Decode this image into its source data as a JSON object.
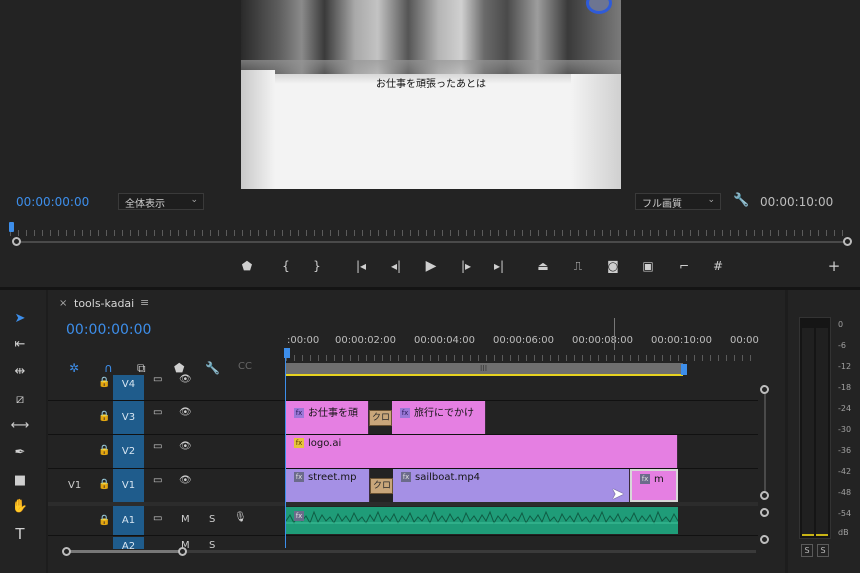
{
  "program_monitor": {
    "caption": "お仕事を頑張ったあとは",
    "current_timecode": "00:00:00:00",
    "zoom": "全体表示",
    "quality": "フル画質",
    "duration": "00:00:10:00"
  },
  "transport_icons": [
    "marker-icon",
    "mark-in-icon",
    "mark-out-icon",
    "go-to-in-icon",
    "step-back-icon",
    "play-icon",
    "step-forward-icon",
    "go-to-out-icon",
    "lift-icon",
    "extract-icon",
    "export-frame-icon",
    "comparison-view-icon",
    "safe-margins-icon",
    "grid-icon",
    "add-button-icon"
  ],
  "tools": [
    "selection-tool-icon",
    "track-select-tool-icon",
    "ripple-edit-tool-icon",
    "razor-tool-icon",
    "slip-tool-icon",
    "pen-tool-icon",
    "rectangle-tool-icon",
    "hand-tool-icon",
    "type-tool-icon"
  ],
  "timeline": {
    "tab_close": "×",
    "sequence_name": "tools-kadai",
    "tab_menu": "≡",
    "timecode": "00:00:00:00",
    "ruler": [
      ":00:00",
      "00:00:02:00",
      "00:00:04:00",
      "00:00:06:00",
      "00:00:08:00",
      "00:00:10:00",
      "00:00"
    ],
    "workarea_grip": "III",
    "tracks": {
      "v4": {
        "name": "V4"
      },
      "v3": {
        "name": "V3"
      },
      "v2": {
        "name": "V2"
      },
      "v1": {
        "name": "V1",
        "source": "V1"
      },
      "a1": {
        "name": "A1",
        "mute": "M",
        "solo": "S"
      },
      "a2": {
        "name": "A2",
        "mute": "M",
        "solo": "S"
      }
    },
    "clips": {
      "v3_title1": "お仕事を頑",
      "v3_transition": "クロ",
      "v3_title2": "旅行にでかけ",
      "v2_logo": "logo.ai",
      "v1_street": "street.mp",
      "v1_transition": "クロ",
      "v1_sailboat": "sailboat.mp4",
      "v1_end": "m",
      "fx_badge": "fx"
    }
  },
  "meters": {
    "scale": [
      "0",
      "-6",
      "-12",
      "-18",
      "-24",
      "-30",
      "-36",
      "-42",
      "-48",
      "-54",
      "dB"
    ],
    "solo_left": "S",
    "solo_right": "S"
  }
}
